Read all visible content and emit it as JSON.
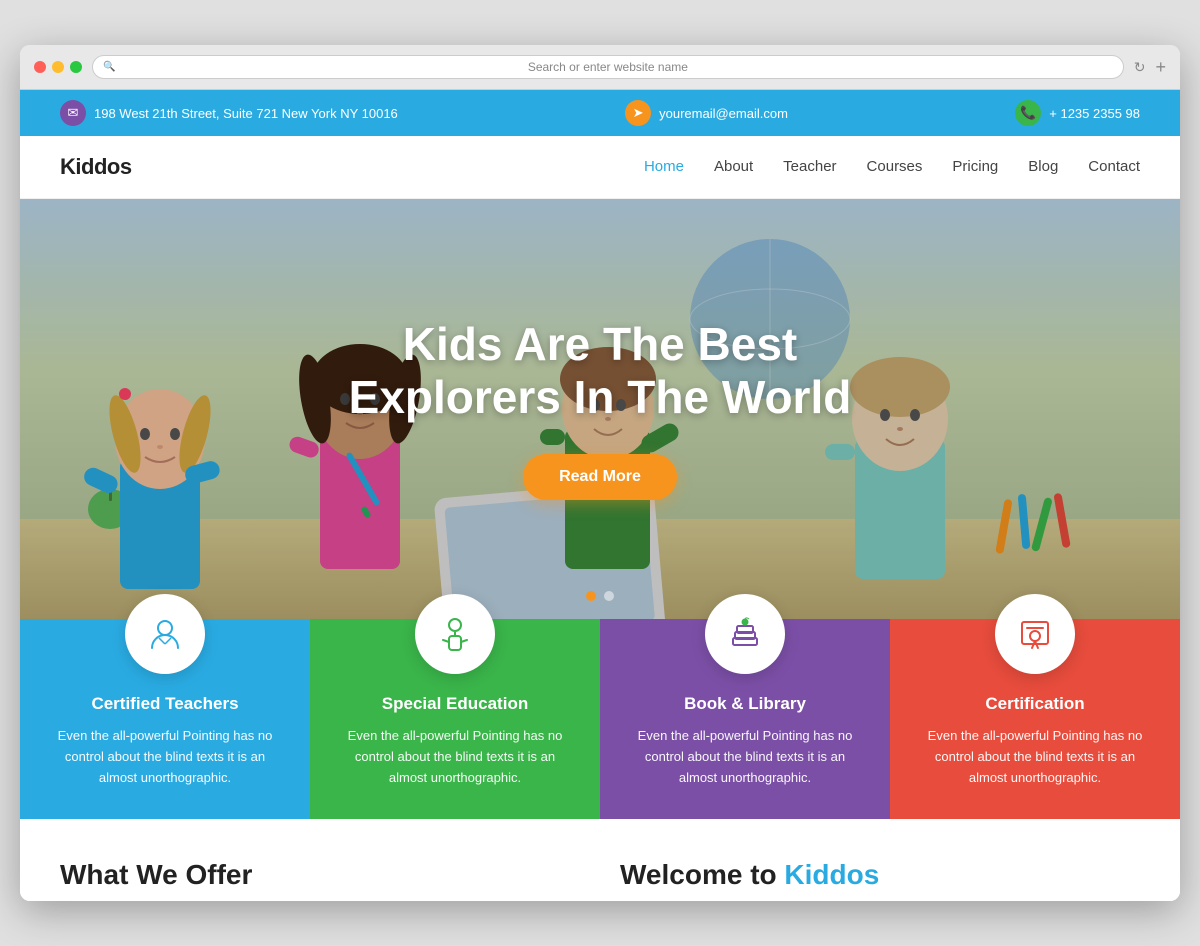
{
  "browser": {
    "address_placeholder": "Search or enter website name"
  },
  "topbar": {
    "address": "198 West 21th Street, Suite 721 New York NY 10016",
    "email": "youremail@email.com",
    "phone": "+ 1235 2355 98"
  },
  "navbar": {
    "logo": "Kiddos",
    "links": [
      {
        "label": "Home",
        "active": true
      },
      {
        "label": "About",
        "active": false
      },
      {
        "label": "Teacher",
        "active": false
      },
      {
        "label": "Courses",
        "active": false
      },
      {
        "label": "Pricing",
        "active": false
      },
      {
        "label": "Blog",
        "active": false
      },
      {
        "label": "Contact",
        "active": false
      }
    ]
  },
  "hero": {
    "title_line1": "Kids Are The Best",
    "title_line2": "Explorers In The World",
    "button_label": "Read More"
  },
  "features": [
    {
      "id": "certified-teachers",
      "title": "Certified Teachers",
      "description": "Even the all-powerful Pointing has no control about the blind texts it is an almost unorthographic.",
      "color": "blue",
      "icon": "teacher"
    },
    {
      "id": "special-education",
      "title": "Special Education",
      "description": "Even the all-powerful Pointing has no control about the blind texts it is an almost unorthographic.",
      "color": "green",
      "icon": "student"
    },
    {
      "id": "book-library",
      "title": "Book & Library",
      "description": "Even the all-powerful Pointing has no control about the blind texts it is an almost unorthographic.",
      "color": "purple",
      "icon": "books"
    },
    {
      "id": "certification",
      "title": "Certification",
      "description": "Even the all-powerful Pointing has no control about the blind texts it is an almost unorthographic.",
      "color": "red",
      "icon": "certificate"
    }
  ],
  "bottom": {
    "what_we_offer": "What We Offer",
    "welcome": "Welcome to Kiddos"
  }
}
